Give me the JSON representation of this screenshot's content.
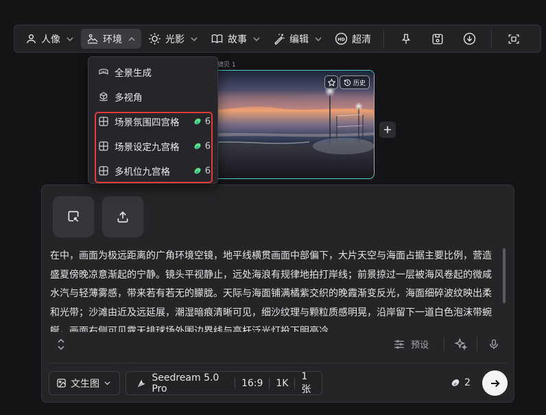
{
  "toolbar": {
    "items": [
      {
        "label": "人像",
        "icon": "person-icon"
      },
      {
        "label": "环境",
        "icon": "landscape-icon"
      },
      {
        "label": "光影",
        "icon": "sun-icon"
      },
      {
        "label": "故事",
        "icon": "book-icon"
      },
      {
        "label": "编辑",
        "icon": "magic-wand-icon"
      },
      {
        "label": "超清",
        "icon": "hd-icon"
      }
    ],
    "right_icons": [
      "pin-icon",
      "save-icon",
      "download-icon",
      "crop-icon"
    ]
  },
  "dropdown": {
    "items": [
      {
        "label": "全景生成",
        "icon": "panorama-icon",
        "cost": ""
      },
      {
        "label": "多视角",
        "icon": "multi-view-icon",
        "cost": ""
      },
      {
        "label": "场景氛围四宫格",
        "icon": "grid-icon",
        "cost": "6"
      },
      {
        "label": "场景设定九宫格",
        "icon": "grid-icon",
        "cost": "6"
      },
      {
        "label": "多机位九宫格",
        "icon": "grid-icon",
        "cost": "6"
      }
    ],
    "highlight_color": "#e23b3b"
  },
  "canvas": {
    "page_label": "镜贝 1",
    "history_label": "历史",
    "accent": "#4fd3c4"
  },
  "prompt": {
    "text": "在中，画面为极远距离的广角环境空镜，地平线横贯画面中部偏下，大片天空与海面占据主要比例，营造盛夏傍晚凉意渐起的宁静。镜头平视静止，远处海浪有规律地拍打岸线；前景掠过一层被海风卷起的微咸水汽与轻薄雾感，带来若有若无的朦胧。天际与海面铺满橘紫交织的晚霞渐变反光，海面细碎波纹映出柔和光带；沙滩由近及远延展，潮湿暗痕清晰可见，细沙纹理与颗粒质感明晃，沿岸留下一道白色泡沫带蜿蜒，画面右侧可见露天排球场外围边界线与高杆泛光灯投下明亮冷"
  },
  "controls": {
    "preset_label": "预设",
    "mode_label": "文生图",
    "model_label": "Seedream 5.0 Pro",
    "ratio_label": "16:9",
    "resolution_label": "1K",
    "count_label": "1张",
    "credit_label": "2"
  }
}
